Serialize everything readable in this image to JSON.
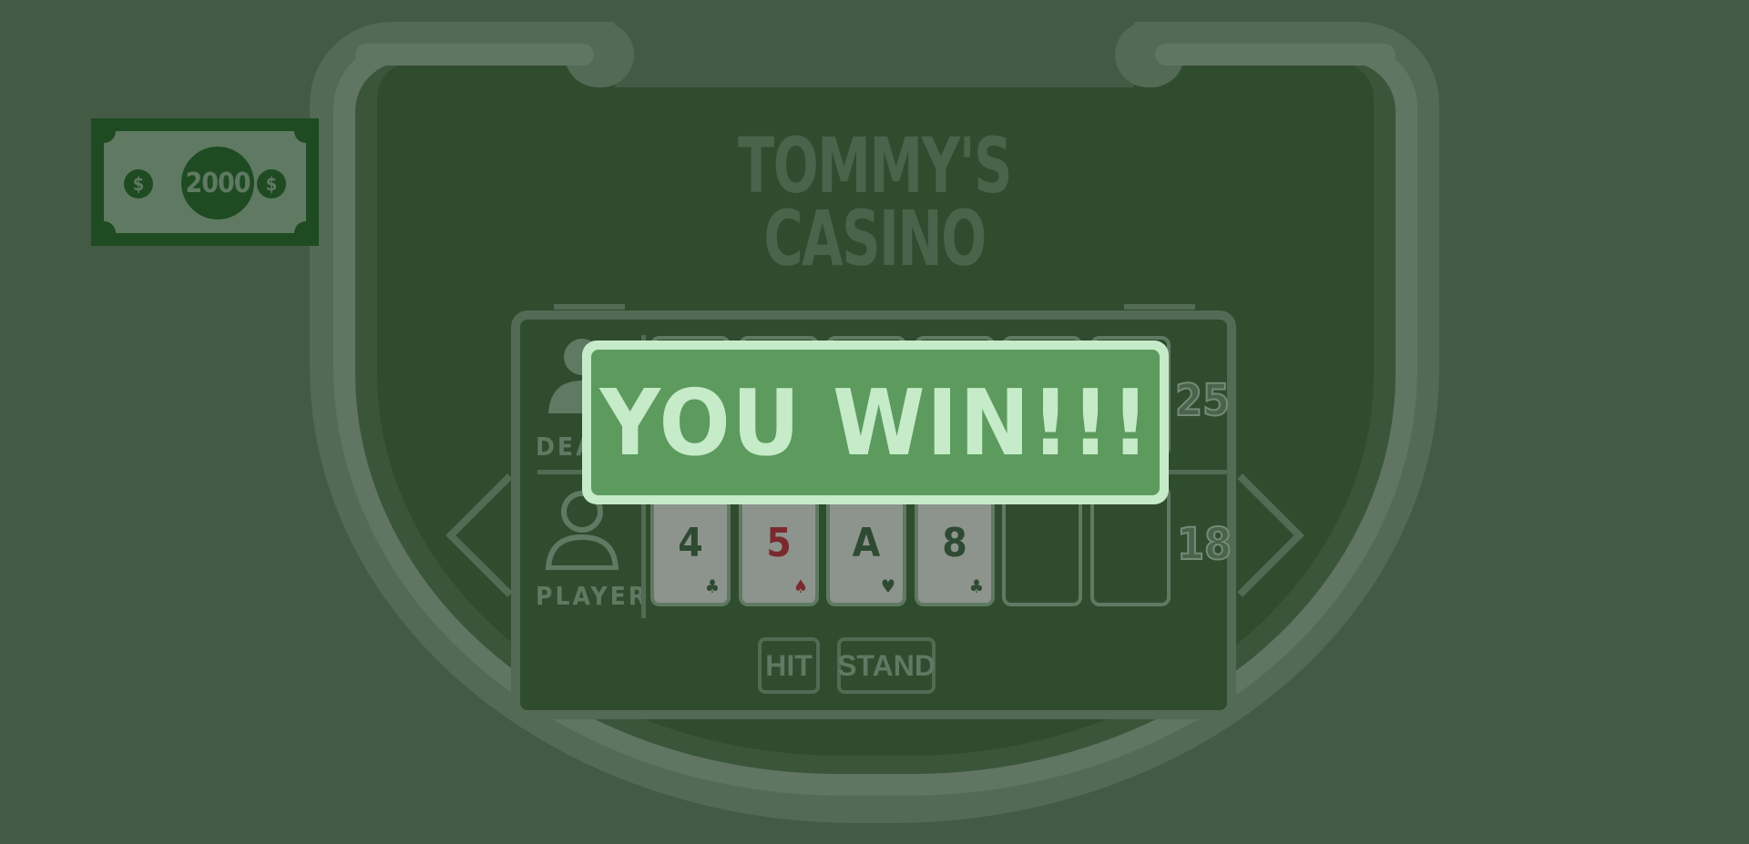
{
  "table": {
    "title_line1": "TOMMY'S",
    "title_line2": "CASINO"
  },
  "bankroll": {
    "amount": "2000",
    "currency_symbol": "$"
  },
  "dealer": {
    "label": "DEALER",
    "score": "25"
  },
  "player": {
    "label": "PLAYER",
    "score": "18",
    "cards": [
      {
        "rank": "4",
        "suit": "♣",
        "color": "#2f4a32"
      },
      {
        "rank": "5",
        "suit": "♠",
        "color": "#7a2a2e"
      },
      {
        "rank": "A",
        "suit": "♥",
        "color": "#2f4a32"
      },
      {
        "rank": "8",
        "suit": "♣",
        "color": "#2f4a32"
      }
    ]
  },
  "controls": {
    "hit_label": "HIT",
    "stand_label": "STAND"
  },
  "result": {
    "message": "YOU WIN!!!"
  },
  "colors": {
    "background": "#435a44",
    "felt": "#2f4c2f",
    "banner_fill": "#5c9a5e",
    "banner_border": "#c6ebc8"
  }
}
